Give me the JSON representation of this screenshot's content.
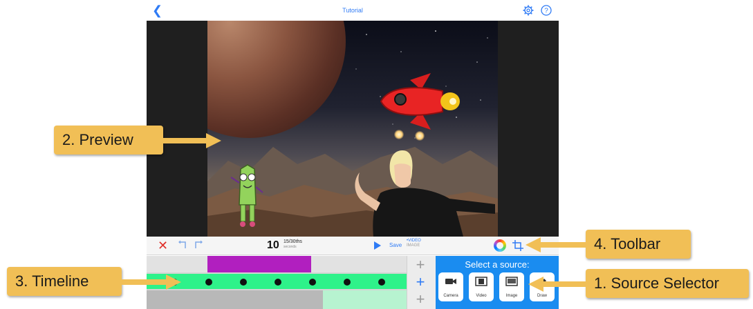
{
  "app": {
    "title": "Tutorial"
  },
  "toolbar": {
    "time_seconds": "10",
    "time_frames": "15/30ths",
    "time_unit": "seconds",
    "save_label": "Save",
    "mode_video": "•VIDEO",
    "mode_image": "IMAGE"
  },
  "source_selector": {
    "title": "Select a source:",
    "options": [
      {
        "label": "Camera",
        "icon": "video-camera-icon"
      },
      {
        "label": "Video",
        "icon": "film-icon"
      },
      {
        "label": "Image",
        "icon": "image-icon"
      },
      {
        "label": "Draw",
        "icon": "draw-icon"
      }
    ]
  },
  "annotations": [
    {
      "label": "2. Preview"
    },
    {
      "label": "4. Toolbar"
    },
    {
      "label": "3. Timeline"
    },
    {
      "label": "1. Source Selector"
    }
  ],
  "colors": {
    "accent": "#2f7bf5",
    "callout": "#f1bf56",
    "source_panel": "#1a8cf0",
    "timeline_green": "#2ef28a",
    "timeline_purple": "#b11fbf",
    "delete_red": "#e0302a"
  }
}
